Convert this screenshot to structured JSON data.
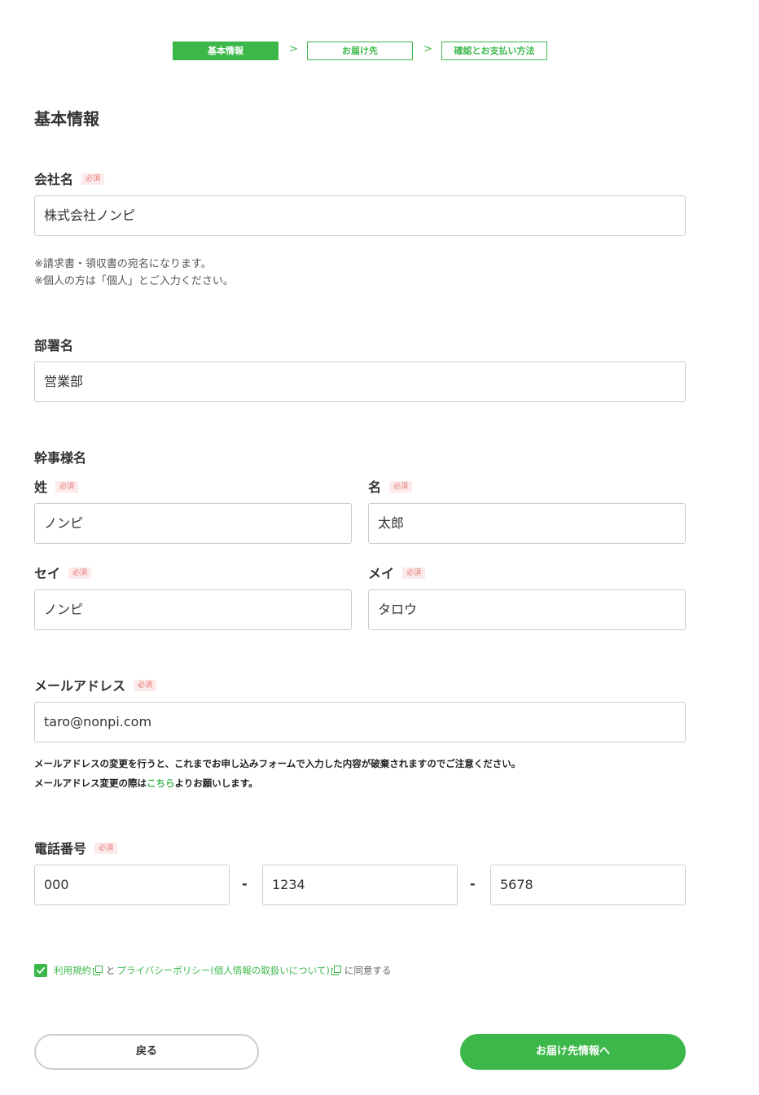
{
  "steps": [
    {
      "label": "基本情報",
      "active": true
    },
    {
      "label": "お届け先",
      "active": false
    },
    {
      "label": "確認とお支払い方法",
      "active": false
    }
  ],
  "step_arrow": ">",
  "page_title": "基本情報",
  "required_badge": "必須",
  "company": {
    "label": "会社名",
    "value": "株式会社ノンピ",
    "notes": [
      "※請求書・領収書の宛名になります。",
      "※個人の方は「個人」とご入力ください。"
    ]
  },
  "department": {
    "label": "部署名",
    "value": "営業部"
  },
  "organizer": {
    "heading": "幹事様名",
    "last_name": {
      "label": "姓",
      "value": "ノンピ"
    },
    "first_name": {
      "label": "名",
      "value": "太郎"
    },
    "last_kana": {
      "label": "セイ",
      "value": "ノンピ"
    },
    "first_kana": {
      "label": "メイ",
      "value": "タロウ"
    }
  },
  "email": {
    "label": "メールアドレス",
    "value": "taro@nonpi.com",
    "warning_1": "メールアドレスの変更を行うと、これまでお申し込みフォームで入力した内容が破棄されますのでご注意ください。",
    "warning_2_pre": "メールアドレス変更の際は",
    "warning_2_link": "こちら",
    "warning_2_post": "よりお願いします。"
  },
  "phone": {
    "label": "電話番号",
    "part1": "000",
    "part2": "1234",
    "part3": "5678",
    "separator": "-"
  },
  "agreement": {
    "checked": true,
    "terms_link": "利用規約",
    "connector": "と",
    "privacy_link": "プライバシーポリシー(個人情報の取扱いについて)",
    "suffix": "に同意する"
  },
  "buttons": {
    "back": "戻る",
    "next": "お届け先情報へ"
  },
  "colors": {
    "accent": "#3cb84a",
    "required_text": "#e57a7a",
    "required_bg": "#fdeaea"
  }
}
